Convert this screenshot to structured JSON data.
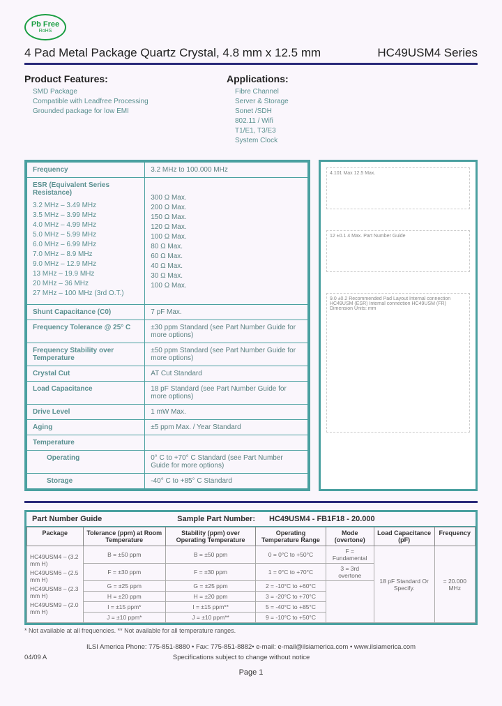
{
  "badge": {
    "main": "Pb Free",
    "sub": "RoHS"
  },
  "header": {
    "title": "4 Pad Metal Package Quartz Crystal, 4.8 mm x 12.5 mm",
    "series": "HC49USM4 Series"
  },
  "features": {
    "heading": "Product Features:",
    "items": [
      "SMD Package",
      "Compatible with Leadfree Processing",
      "Grounded package for low EMI"
    ]
  },
  "applications": {
    "heading": "Applications:",
    "items": [
      "Fibre Channel",
      "Server & Storage",
      "Sonet /SDH",
      "802.11 / Wifi",
      "T1/E1, T3/E3",
      "System Clock"
    ]
  },
  "diagram_labels": {
    "top": "4.101 Max   12.5 Max.",
    "mid": "12 ±0.1   4 Max. Part Number Guide",
    "bot": "9.0 ±0.2   Recommended Pad Layout   Internal connection HC49USM (ESR)   Internal connection HC49USM (FR)   Dimension Units: mm"
  },
  "specs": [
    {
      "label": "Frequency",
      "value": "3.2 MHz to 100.000 MHz"
    },
    {
      "label_esr": "ESR (Equivalent Series Resistance)",
      "ranges": [
        "3.2 MHz – 3.49 MHz",
        "3.5 MHz – 3.99 MHz",
        "4.0 MHz – 4.99 MHz",
        "5.0 MHz – 5.99 MHz",
        "6.0 MHz – 6.99 MHz",
        "7.0 MHz – 8.9 MHz",
        "9.0 MHz – 12.9 MHz",
        "13 MHz – 19.9 MHz",
        "20 MHz – 36 MHz",
        "27 MHz – 100 MHz (3rd O.T.)"
      ],
      "values": [
        "300 Ω Max.",
        "200 Ω Max.",
        "150 Ω Max.",
        "120 Ω Max.",
        "100 Ω Max.",
        "80 Ω Max.",
        "60 Ω Max.",
        "40 Ω Max.",
        "30 Ω Max.",
        "100 Ω Max."
      ]
    },
    {
      "label": "Shunt Capacitance (C0)",
      "value": "7 pF Max."
    },
    {
      "label": "Frequency Tolerance @ 25° C",
      "value": "±30 ppm Standard (see Part Number Guide for more options)"
    },
    {
      "label": "Frequency Stability over Temperature",
      "value": "±50 ppm Standard (see Part Number Guide for more options)"
    },
    {
      "label": "Crystal Cut",
      "value": "AT Cut Standard"
    },
    {
      "label": "Load Capacitance",
      "value": "18 pF Standard (see Part Number Guide for more options)"
    },
    {
      "label": "Drive Level",
      "value": "1 mW Max."
    },
    {
      "label": "Aging",
      "value": "±5 ppm Max. / Year Standard"
    },
    {
      "label": "Temperature",
      "value": ""
    },
    {
      "label_indent": "Operating",
      "value": "0° C to +70° C Standard (see Part Number Guide for more options)"
    },
    {
      "label_indent": "Storage",
      "value": "-40° C to +85° C Standard"
    }
  ],
  "part_number_guide": {
    "title": "Part Number Guide",
    "sample_label": "Sample Part Number:",
    "sample_value": "HC49USM4 - FB1F18 - 20.000",
    "columns": [
      "Package",
      "Tolerance (ppm) at Room Temperature",
      "Stability (ppm) over Operating Temperature",
      "Operating Temperature Range",
      "Mode (overtone)",
      "Load Capacitance (pF)",
      "Frequency"
    ],
    "packages": [
      "HC49USM4 – (3.2 mm H)",
      "HC49USM6 – (2.5 mm H)",
      "HC49USM8 – (2.3 mm H)",
      "HC49USM9 – (2.0 mm H)"
    ],
    "tolerance": [
      "B = ±50 ppm",
      "F = ±30 ppm",
      "G = ±25 ppm",
      "H = ±20 ppm",
      "I = ±15 ppm*",
      "J = ±10 ppm*"
    ],
    "stability": [
      "B = ±50 ppm",
      "F = ±30 ppm",
      "G = ±25 ppm",
      "H = ±20 ppm",
      "I = ±15 ppm**",
      "J = ±10 ppm**"
    ],
    "op_temp": [
      "0 = 0°C to +50°C",
      "1 = 0°C to +70°C",
      "2 = -10°C to +60°C",
      "3 = -20°C to +70°C",
      "5 = -40°C to +85°C",
      "9 = -10°C to +50°C"
    ],
    "mode": [
      "F = Fundamental",
      "3 = 3rd overtone"
    ],
    "load_cap": "18 pF Standard Or Specify.",
    "freq_example": "= 20.000 MHz"
  },
  "footnote": "*  Not available at all frequencies.    ** Not available for all temperature ranges.",
  "footer": {
    "line1": "ILSI America  Phone: 775-851-8880 • Fax: 775-851-8882• e-mail: e-mail@ilsiamerica.com • www.ilsiamerica.com",
    "rev": "04/09  A",
    "notice": "Specifications subject to change without notice",
    "page": "Page 1"
  }
}
